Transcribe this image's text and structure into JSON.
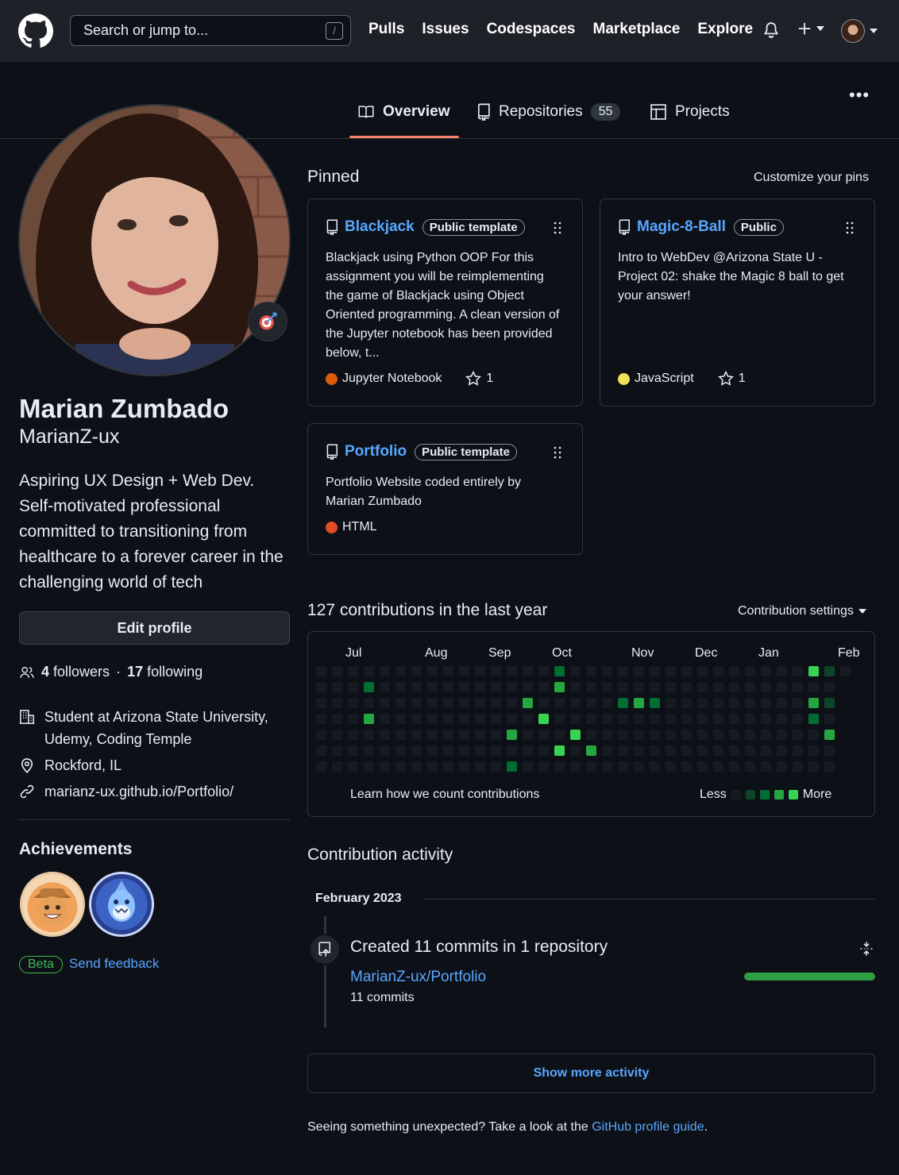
{
  "topbar": {
    "search_placeholder": "Search or jump to...",
    "slash_key": "/",
    "nav": [
      "Pulls",
      "Issues",
      "Codespaces",
      "Marketplace",
      "Explore"
    ]
  },
  "tabs": {
    "overview": "Overview",
    "repositories": "Repositories",
    "repositories_count": "55",
    "projects": "Projects"
  },
  "profile": {
    "name": "Marian Zumbado",
    "login": "MarianZ-ux",
    "bio": "Aspiring UX Design + Web Dev. Self-motivated professional committed to transitioning from healthcare to a forever career in the challenging world of tech",
    "edit_label": "Edit profile",
    "followers_count": "4",
    "followers_label": "followers",
    "dot": "·",
    "following_count": "17",
    "following_label": "following",
    "organization": "Student at Arizona State University, Udemy, Coding Temple",
    "location": "Rockford, IL",
    "website": "marianz-ux.github.io/Portfolio/"
  },
  "achievements": {
    "title": "Achievements",
    "beta": "Beta",
    "feedback": "Send feedback"
  },
  "pinned": {
    "title": "Pinned",
    "customize": "Customize your pins",
    "cards": [
      {
        "name": "Blackjack",
        "visibility": "Public template",
        "description": "Blackjack using Python OOP For this assignment you will be reimplementing the game of Blackjack using Object Oriented programming. A clean version of the Jupyter notebook has been provided below, t...",
        "language": "Jupyter Notebook",
        "language_color": "#DA5B0B",
        "stars": "1"
      },
      {
        "name": "Magic-8-Ball",
        "visibility": "Public",
        "description": "Intro to WebDev @Arizona State U - Project 02: shake the Magic 8 ball to get your answer!",
        "language": "JavaScript",
        "language_color": "#f1e05a",
        "stars": "1"
      },
      {
        "name": "Portfolio",
        "visibility": "Public template",
        "description": "Portfolio Website coded entirely by Marian Zumbado",
        "language": "HTML",
        "language_color": "#e34c26",
        "stars": ""
      }
    ]
  },
  "contributions": {
    "title": "127 contributions in the last year",
    "settings": "Contribution settings",
    "months": [
      "Jul",
      "Aug",
      "Sep",
      "Oct",
      "Nov",
      "Dec",
      "Jan",
      "Feb"
    ],
    "learn": "Learn how we count contributions",
    "less": "Less",
    "more": "More",
    "level_colors": [
      "#161b22",
      "#0e4429",
      "#006d32",
      "#26a641",
      "#39d353"
    ]
  },
  "activity": {
    "title": "Contribution activity",
    "month": "February 2023",
    "summary": "Created 11 commits in 1 repository",
    "repo": "MarianZ-ux/Portfolio",
    "commits": "11 commits",
    "show_more": "Show more activity",
    "footer_text": "Seeing something unexpected? Take a look at the",
    "footer_link": "GitHub profile guide",
    "footer_end": "."
  }
}
